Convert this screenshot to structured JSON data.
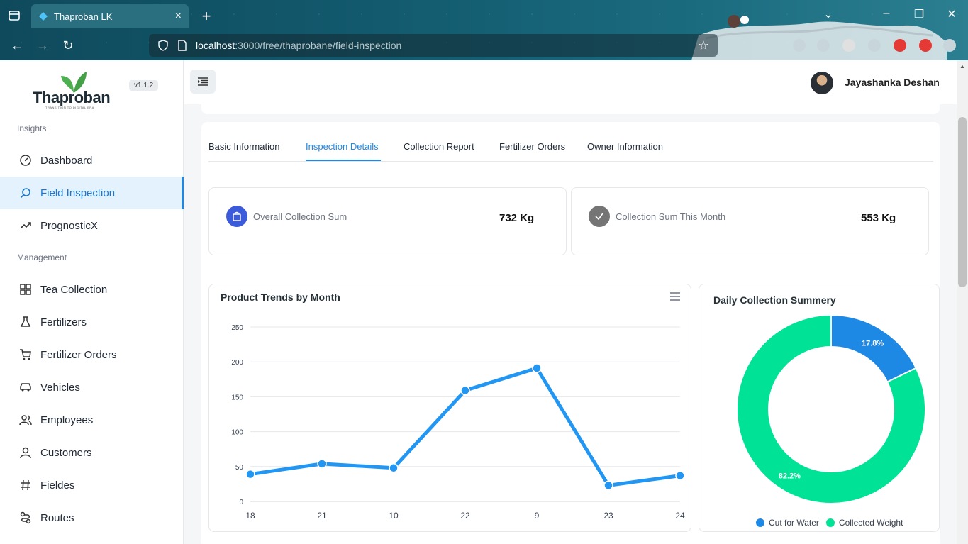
{
  "browser": {
    "tab_title": "Thaproban LK",
    "url_host": "localhost",
    "url_path": ":3000/free/thaprobane/field-inspection"
  },
  "sidebar": {
    "logo_text": "Thaproban",
    "logo_tagline": "TRANSITION TO DIGITAL ERA",
    "version": "v1.1.2",
    "sections": {
      "insights": "Insights",
      "management": "Management"
    },
    "items": [
      {
        "label": "Dashboard",
        "icon": "dashboard-gauge-icon"
      },
      {
        "label": "Field Inspection",
        "icon": "search-icon",
        "active": true
      },
      {
        "label": "PrognosticX",
        "icon": "trending-up-icon"
      },
      {
        "label": "Tea Collection",
        "icon": "grid-icon"
      },
      {
        "label": "Fertilizers",
        "icon": "flask-icon"
      },
      {
        "label": "Fertilizer Orders",
        "icon": "cart-icon"
      },
      {
        "label": "Vehicles",
        "icon": "car-icon"
      },
      {
        "label": "Employees",
        "icon": "users-icon"
      },
      {
        "label": "Customers",
        "icon": "user-icon"
      },
      {
        "label": "Fieldes",
        "icon": "hash-icon"
      },
      {
        "label": "Routes",
        "icon": "route-icon"
      }
    ]
  },
  "header": {
    "username": "Jayashanka Deshan"
  },
  "tabs": [
    "Basic Information",
    "Inspection Details",
    "Collection Report",
    "Fertilizer Orders",
    "Owner Information"
  ],
  "active_tab": "Inspection Details",
  "stats": [
    {
      "label": "Overall Collection Sum",
      "value": "732 Kg",
      "icon": "shopping-bag-icon",
      "color": "#3b5bdb"
    },
    {
      "label": "Collection Sum This Month",
      "value": "553 Kg",
      "icon": "check-icon",
      "color": "#757575"
    }
  ],
  "line_chart_title": "Product Trends by Month",
  "donut_chart_title": "Daily Collection Summery",
  "colors": {
    "accent": "#1e88e5",
    "line": "#2196f3",
    "donut_blue": "#1e88e5",
    "donut_green": "#00e396"
  },
  "chart_data": [
    {
      "type": "line",
      "title": "Product Trends by Month",
      "categories": [
        "18",
        "21",
        "10",
        "22",
        "9",
        "23",
        "24"
      ],
      "series": [
        {
          "values": [
            39,
            54,
            48,
            159,
            191,
            23,
            37
          ]
        }
      ],
      "ylim": [
        0,
        250
      ],
      "yticks": [
        "0",
        "50",
        "100",
        "150",
        "200",
        "250"
      ],
      "grid": true
    },
    {
      "type": "pie",
      "title": "Daily Collection Summery",
      "labels": [
        "Cut for Water",
        "Collected Weight"
      ],
      "values": [
        17.8,
        82.2
      ],
      "value_labels": [
        "17.8%",
        "82.2%"
      ],
      "legend": "bottom"
    }
  ]
}
